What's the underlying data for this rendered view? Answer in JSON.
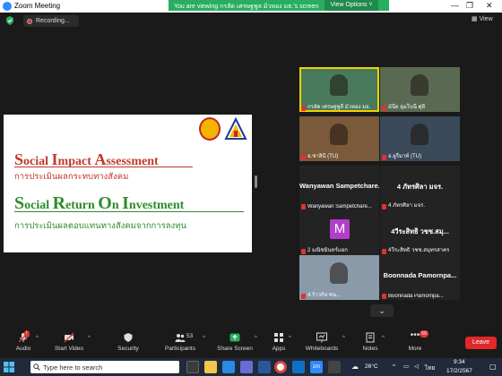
{
  "window": {
    "title": "Zoom Meeting",
    "viewing_banner": "You are viewing กรลัด เศรษฐพูล ม้วหอง มธ.'s screen",
    "view_options": "View Options"
  },
  "recording": {
    "label": "Recording..."
  },
  "top_right": {
    "view_label": "View"
  },
  "slide": {
    "line1": {
      "initial_s": "S",
      "rest_s": "ocial ",
      "initial_i": "I",
      "rest_i": "mpact ",
      "initial_a": "A",
      "rest_a": "ssessment"
    },
    "line1_thai": "การประเมินผลกระทบทางสังคม",
    "line2": {
      "initial_s": "S",
      "rest_s": "ocial ",
      "initial_r": "R",
      "rest_r": "eturn ",
      "initial_o": "O",
      "rest_o": "n ",
      "initial_i": "I",
      "rest_i": "nvestment"
    },
    "line2_thai": "การประเมินผลตอบแทนทางสังคมจากการลงทุน"
  },
  "participants_gallery": [
    {
      "name": "กรลัด เศรษฐพูลี ม้วหอง มธ.",
      "type": "video",
      "active": true,
      "color": "#4a7a5c"
    },
    {
      "name": "ม้นีย อุมโบนี ศุลี",
      "type": "video",
      "active": false,
      "color": "#5a6a52"
    },
    {
      "name": "อ.ชาลินี (TU)",
      "type": "video",
      "active": false,
      "color": "#7a5a3a"
    },
    {
      "name": "อ.ยูรีมาท์ (TU)",
      "type": "video",
      "active": false,
      "color": "#3a4a5a"
    },
    {
      "name": "Wanyawan Sampetchare...",
      "type": "name",
      "center": "Wanyawan Sampetchare..."
    },
    {
      "name": "4 ภัทรศิลา มจร.",
      "type": "name",
      "center": "4 ภัทรศิลา มจร."
    },
    {
      "name": "2 มณิชมินทร์แยก",
      "type": "avatar",
      "avatar": "M"
    },
    {
      "name": "4วีระสิทธิ วชช.สมุทรสาคร",
      "type": "name",
      "center": "4วีระสิทธิ วชช.สมุ..."
    },
    {
      "name": "4.ร้าวกิจ ชน...",
      "type": "video",
      "active": false,
      "color": "#8a9aa8"
    },
    {
      "name": "Boonnada Pamornpa...",
      "type": "name",
      "center": "Boonnada Pamornpa..."
    }
  ],
  "toolbar": {
    "audio": "Audio",
    "video": "Start Video",
    "security": "Security",
    "participants": "Participants",
    "participants_count": "53",
    "share": "Share Screen",
    "apps": "Apps",
    "whiteboards": "Whiteboards",
    "notes": "Notes",
    "more": "More",
    "more_badge": "50",
    "leave": "Leave"
  },
  "taskbar": {
    "search_placeholder": "Type here to search",
    "weather": "26°C",
    "time": "9:34",
    "date": "17/2/2567",
    "lang": "ไทย"
  },
  "colors": {
    "sia": "#c0392b",
    "sroi": "#2e8b2e",
    "zoom_blue": "#2d8cff",
    "green_banner": "#27ae60",
    "leave": "#e02828"
  }
}
